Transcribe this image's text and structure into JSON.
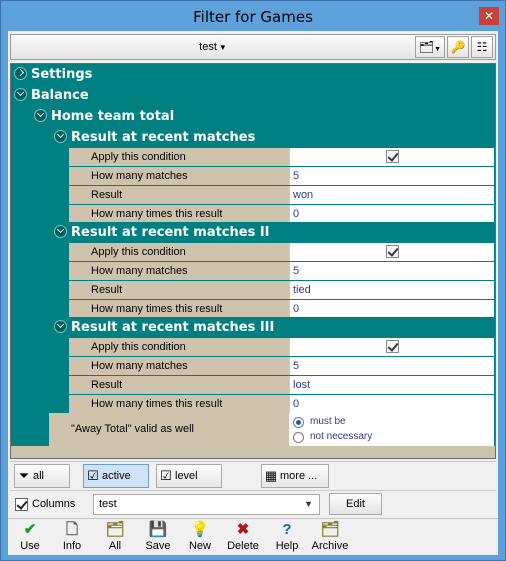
{
  "window": {
    "title": "Filter for Games",
    "close_glyph": "✕"
  },
  "toolbar": {
    "filter_name": "test",
    "buttons": [
      {
        "icon": "folders-icon",
        "glyph": "🗂"
      },
      {
        "icon": "key-icon",
        "glyph": "🔑"
      },
      {
        "icon": "tree-view-icon",
        "glyph": "☷"
      }
    ]
  },
  "tree": {
    "settings": "Settings",
    "balance": "Balance",
    "home_team_total": "Home team total",
    "groups": [
      {
        "title": "Result at recent matches",
        "rows": [
          {
            "label": "Apply this condition",
            "checked": true
          },
          {
            "label": "How many matches",
            "value": "5"
          },
          {
            "label": "Result",
            "value": "won"
          },
          {
            "label": "How many times this result",
            "value": "0"
          }
        ]
      },
      {
        "title": "Result at recent matches II",
        "rows": [
          {
            "label": "Apply this condition",
            "checked": true
          },
          {
            "label": "How many matches",
            "value": "5"
          },
          {
            "label": "Result",
            "value": "tied"
          },
          {
            "label": "How many times this result",
            "value": "0"
          }
        ]
      },
      {
        "title": "Result at recent matches III",
        "rows": [
          {
            "label": "Apply this condition",
            "checked": true
          },
          {
            "label": "How many matches",
            "value": "5"
          },
          {
            "label": "Result",
            "value": "lost"
          },
          {
            "label": "How many times this result",
            "value": "0"
          }
        ]
      }
    ],
    "away_total": {
      "label": "\"Away Total\" valid as well",
      "option_must_be": "must be",
      "option_not_necessary": "not necessary",
      "selected": "must be"
    }
  },
  "view_buttons": {
    "all": "all",
    "active": "active",
    "level": "level",
    "more": "more ..."
  },
  "columns": {
    "label": "Columns",
    "checked": true,
    "selected": "test",
    "edit": "Edit"
  },
  "actions": [
    {
      "label": "Use",
      "icon": "checkmark-icon",
      "glyph": "✔",
      "color": "#1e9a2c"
    },
    {
      "label": "Info",
      "icon": "info-icon",
      "glyph": "🗋",
      "color": "#555555"
    },
    {
      "label": "All",
      "icon": "all-folders-icon",
      "glyph": "🗂",
      "color": "#8a7a30"
    },
    {
      "label": "Save",
      "icon": "save-icon",
      "glyph": "💾",
      "color": "#222222"
    },
    {
      "label": "New",
      "icon": "lightbulb-icon",
      "glyph": "💡",
      "color": "#d6b800"
    },
    {
      "label": "Delete",
      "icon": "delete-icon",
      "glyph": "✖",
      "color": "#b01818"
    },
    {
      "label": "Help",
      "icon": "help-icon",
      "glyph": "?",
      "color": "#1a5fb4"
    },
    {
      "label": "Archive",
      "icon": "archive-icon",
      "glyph": "🗂",
      "color": "#8a7a30"
    }
  ]
}
